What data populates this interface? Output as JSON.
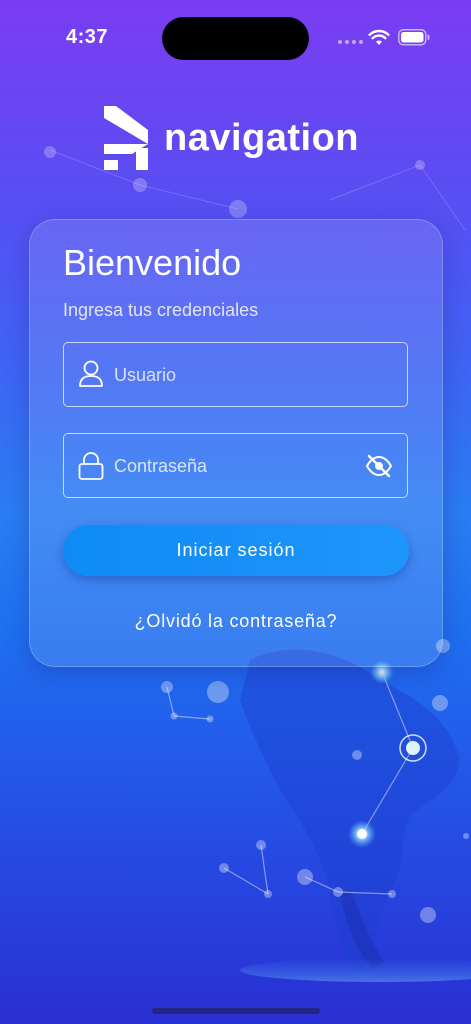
{
  "status": {
    "time": "4:37"
  },
  "brand": {
    "name": "navigation"
  },
  "login": {
    "title": "Bienvenido",
    "subtitle": "Ingresa tus credenciales",
    "username_placeholder": "Usuario",
    "password_placeholder": "Contraseña",
    "submit_label": "Iniciar sesión",
    "forgot_label": "¿Olvidó la contraseña?"
  },
  "colors": {
    "accent": "#1592f8",
    "background_top": "#7b3cf2",
    "background_bottom": "#2a2fd3"
  },
  "icons": [
    "user-icon",
    "lock-icon",
    "eye-off-icon",
    "wifi-icon",
    "battery-icon"
  ]
}
